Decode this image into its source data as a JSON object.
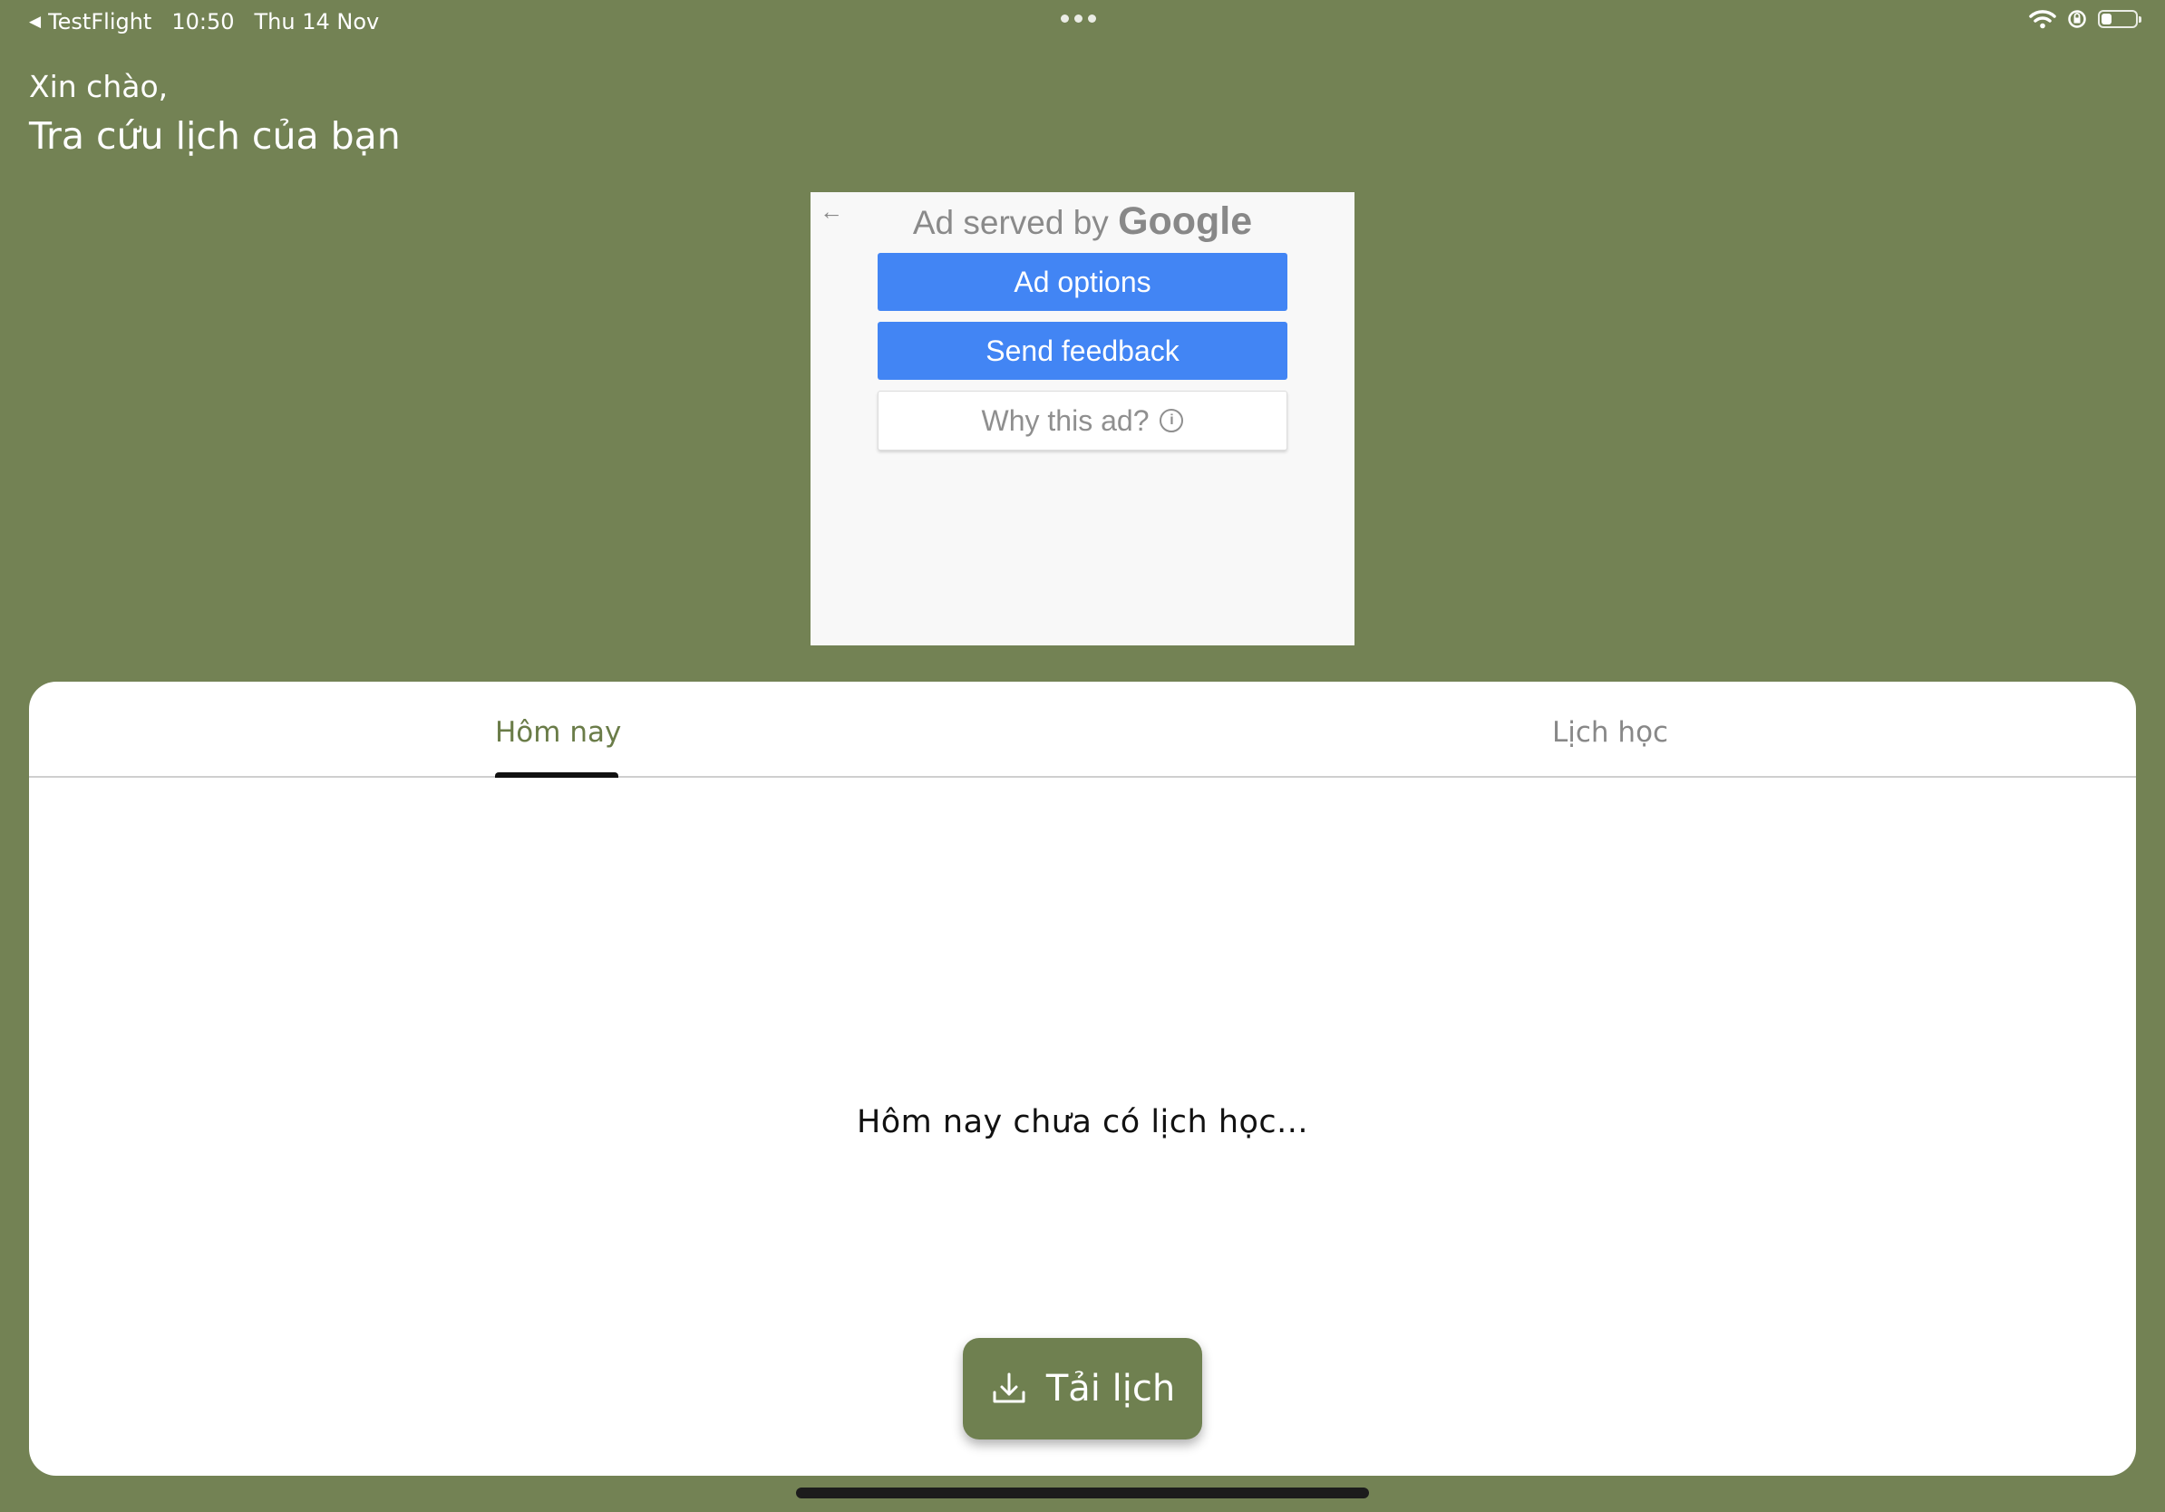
{
  "status_bar": {
    "back_app": "TestFlight",
    "time": "10:50",
    "date": "Thu 14 Nov",
    "battery_level": 0.3
  },
  "header": {
    "greeting": "Xin chào,",
    "title": "Tra cứu lịch của bạn"
  },
  "ad": {
    "served_by": "Ad served by",
    "brand": "Google",
    "options_label": "Ad options",
    "feedback_label": "Send feedback",
    "why_label": "Why this ad?"
  },
  "tabs": [
    {
      "label": "Hôm nay",
      "active": true
    },
    {
      "label": "Lịch học",
      "active": false
    }
  ],
  "main": {
    "empty_message": "Hôm nay chưa có lịch học..."
  },
  "fab": {
    "label": "Tải lịch"
  },
  "colors": {
    "background": "#738254",
    "accent": "#6f8050",
    "ad_button": "#4285f4"
  }
}
